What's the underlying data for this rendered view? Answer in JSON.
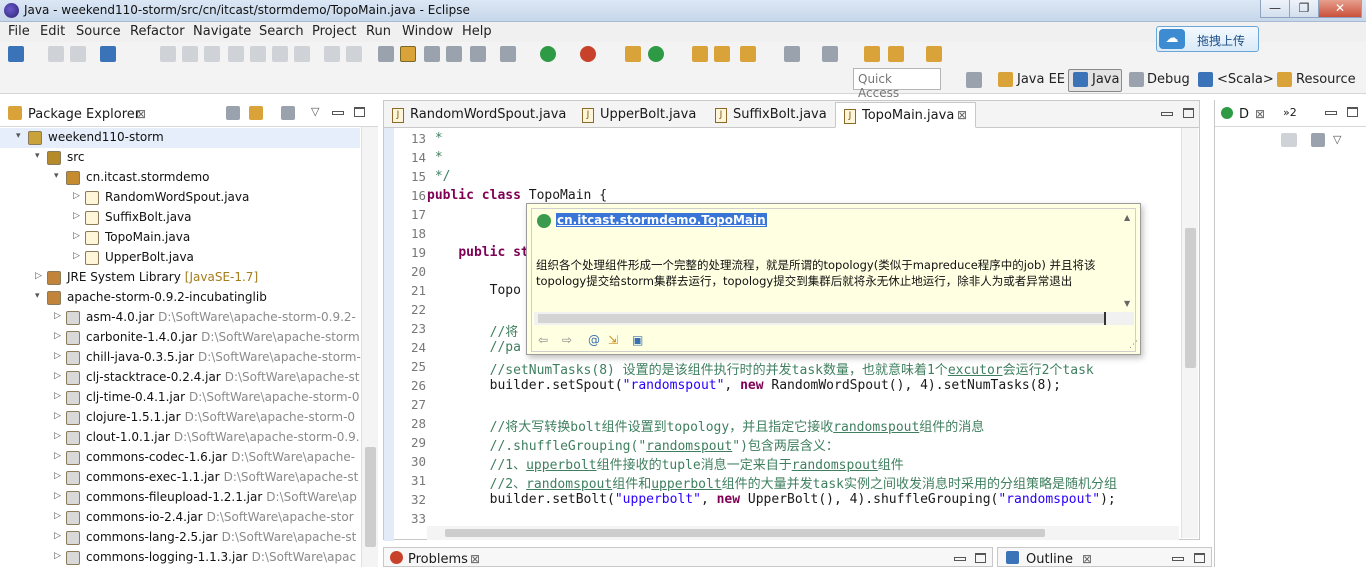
{
  "window": {
    "title": "Java - weekend110-storm/src/cn/itcast/stormdemo/TopoMain.java - Eclipse",
    "minimize_label": "—",
    "maximize_label": "❐",
    "close_label": "✕"
  },
  "menu": [
    "File",
    "Edit",
    "Source",
    "Refactor",
    "Navigate",
    "Search",
    "Project",
    "Run",
    "Window",
    "Help"
  ],
  "upload_widget": {
    "label": "拖拽上传"
  },
  "toolbar": {
    "quick_access_placeholder": "Quick Access",
    "perspectives": [
      "Java EE",
      "Java",
      "Debug",
      "<Scala>",
      "Resource"
    ]
  },
  "package_explorer": {
    "title": "Package Explorer",
    "tree": [
      {
        "label": "weekend110-storm",
        "extra": "",
        "level": 0,
        "arrow": "▾",
        "kind": "project",
        "selected": true
      },
      {
        "label": "src",
        "extra": "",
        "level": 1,
        "arrow": "▾",
        "kind": "srcfolder"
      },
      {
        "label": "cn.itcast.stormdemo",
        "extra": "",
        "level": 2,
        "arrow": "▾",
        "kind": "package"
      },
      {
        "label": "RandomWordSpout.java",
        "extra": "",
        "level": 3,
        "arrow": "▷",
        "kind": "java"
      },
      {
        "label": "SuffixBolt.java",
        "extra": "",
        "level": 3,
        "arrow": "▷",
        "kind": "java"
      },
      {
        "label": "TopoMain.java",
        "extra": "",
        "level": 3,
        "arrow": "▷",
        "kind": "java"
      },
      {
        "label": "UpperBolt.java",
        "extra": "",
        "level": 3,
        "arrow": "▷",
        "kind": "java"
      },
      {
        "label": "JRE System Library",
        "extra": "[JavaSE-1.7]",
        "level": 1,
        "arrow": "▷",
        "kind": "library"
      },
      {
        "label": "apache-storm-0.9.2-incubatinglib",
        "extra": "",
        "level": 1,
        "arrow": "▾",
        "kind": "library"
      },
      {
        "label": "asm-4.0.jar",
        "extra": "D:\\SoftWare\\apache-storm-0.9.2-",
        "level": 2,
        "arrow": "▷",
        "kind": "jar"
      },
      {
        "label": "carbonite-1.4.0.jar",
        "extra": "D:\\SoftWare\\apache-storm",
        "level": 2,
        "arrow": "▷",
        "kind": "jar"
      },
      {
        "label": "chill-java-0.3.5.jar",
        "extra": "D:\\SoftWare\\apache-storm-",
        "level": 2,
        "arrow": "▷",
        "kind": "jar"
      },
      {
        "label": "clj-stacktrace-0.2.4.jar",
        "extra": "D:\\SoftWare\\apache-st",
        "level": 2,
        "arrow": "▷",
        "kind": "jar"
      },
      {
        "label": "clj-time-0.4.1.jar",
        "extra": "D:\\SoftWare\\apache-storm-0",
        "level": 2,
        "arrow": "▷",
        "kind": "jar"
      },
      {
        "label": "clojure-1.5.1.jar",
        "extra": "D:\\SoftWare\\apache-storm-0",
        "level": 2,
        "arrow": "▷",
        "kind": "jar"
      },
      {
        "label": "clout-1.0.1.jar",
        "extra": "D:\\SoftWare\\apache-storm-0.9.",
        "level": 2,
        "arrow": "▷",
        "kind": "jar"
      },
      {
        "label": "commons-codec-1.6.jar",
        "extra": "D:\\SoftWare\\apache-",
        "level": 2,
        "arrow": "▷",
        "kind": "jar"
      },
      {
        "label": "commons-exec-1.1.jar",
        "extra": "D:\\SoftWare\\apache-st",
        "level": 2,
        "arrow": "▷",
        "kind": "jar"
      },
      {
        "label": "commons-fileupload-1.2.1.jar",
        "extra": "D:\\SoftWare\\ap",
        "level": 2,
        "arrow": "▷",
        "kind": "jar"
      },
      {
        "label": "commons-io-2.4.jar",
        "extra": "D:\\SoftWare\\apache-stor",
        "level": 2,
        "arrow": "▷",
        "kind": "jar"
      },
      {
        "label": "commons-lang-2.5.jar",
        "extra": "D:\\SoftWare\\apache-st",
        "level": 2,
        "arrow": "▷",
        "kind": "jar"
      },
      {
        "label": "commons-logging-1.1.3.jar",
        "extra": "D:\\SoftWare\\apac",
        "level": 2,
        "arrow": "▷",
        "kind": "jar"
      }
    ]
  },
  "editor": {
    "tabs": [
      {
        "label": "RandomWordSpout.java",
        "active": false
      },
      {
        "label": "UpperBolt.java",
        "active": false
      },
      {
        "label": "SuffixBolt.java",
        "active": false
      },
      {
        "label": "TopoMain.java",
        "active": true
      }
    ],
    "lines": [
      {
        "n": "13",
        "html": " <span class=\"cm\">*</span>"
      },
      {
        "n": "14",
        "html": " <span class=\"cm\">*</span>"
      },
      {
        "n": "15",
        "html": " <span class=\"cm\">*/</span>"
      },
      {
        "n": "16",
        "html": "<span class=\"kw\">public class</span> TopoMain {"
      },
      {
        "n": "17",
        "html": ""
      },
      {
        "n": "18",
        "html": ""
      },
      {
        "n": "19",
        "html": "    <span class=\"kw\">public st</span>"
      },
      {
        "n": "20",
        "html": ""
      },
      {
        "n": "21",
        "html": "        Topo"
      },
      {
        "n": "22",
        "html": ""
      },
      {
        "n": "23",
        "html": "        <span class=\"cm\">//将</span>"
      },
      {
        "n": "24",
        "html": "        <span class=\"cm\">//pa</span>"
      },
      {
        "n": "25",
        "html": "        <span class=\"cm\">//setNumTasks(8) 设置的是该组件执行时的并发task数量，也就意味着1个<span class=\"ul\">excutor</span>会运行2个task</span>"
      },
      {
        "n": "26",
        "html": "        builder.setSpout(<span class=\"str\">\"randomspout\"</span>, <span class=\"kw\">new</span> RandomWordSpout(), 4).setNumTasks(8);"
      },
      {
        "n": "27",
        "html": ""
      },
      {
        "n": "28",
        "html": "        <span class=\"cm\">//将大写转换bolt组件设置到topology，并且指定它接收<span class=\"ul\">randomspout</span>组件的消息</span>"
      },
      {
        "n": "29",
        "html": "        <span class=\"cm\">//.shuffleGrouping(\"<span class=\"ul\">randomspout</span>\")包含两层含义：</span>"
      },
      {
        "n": "30",
        "html": "        <span class=\"cm\">//1、<span class=\"ul\">upperbolt</span>组件接收的tuple消息一定来自于<span class=\"ul\">randomspout</span>组件</span>"
      },
      {
        "n": "31",
        "html": "        <span class=\"cm\">//2、<span class=\"ul\">randomspout</span>组件和<span class=\"ul\">upperbolt</span>组件的大量并发task实例之间收发消息时采用的分组策略是随机分组</span>"
      },
      {
        "n": "32",
        "html": "        builder.setBolt(<span class=\"str\">\"upperbolt\"</span>, <span class=\"kw\">new</span> UpperBolt(), 4).shuffleGrouping(<span class=\"str\">\"randomspout\"</span>);"
      },
      {
        "n": "33",
        "html": ""
      }
    ],
    "hover": {
      "class_name": "cn.itcast.stormdemo.TopoMain",
      "doc_line1": "组织各个处理组件形成一个完整的处理流程，就是所谓的topology(类似于mapreduce程序中的job) 并且将该",
      "doc_line2": "topology提交给storm集群去运行，topology提交到集群后就将永无休止地运行，除非人为或者异常退出"
    }
  },
  "right_view": {
    "tab_label": "D",
    "tab2_label": "»2"
  },
  "bottom": {
    "problems_label": "Problems",
    "outline_label": "Outline"
  }
}
